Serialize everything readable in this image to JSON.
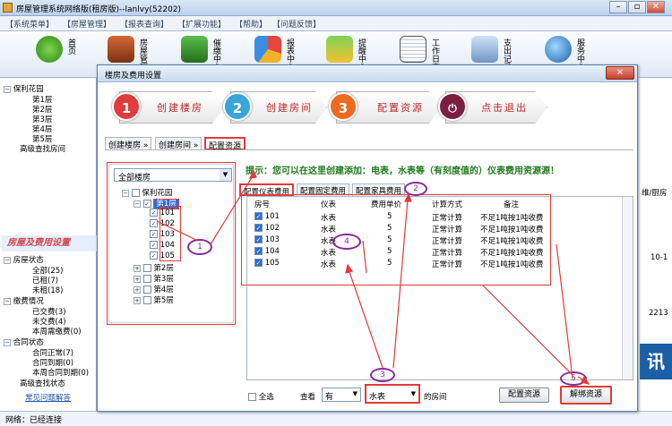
{
  "window": {
    "title": "房屋管理系统网络版(租房版)--lanlvy(52202)"
  },
  "menu": [
    "【系统菜单】",
    "【房屋管理】",
    "【报表查询】",
    "【扩展功能】",
    "【帮助】",
    "【问题反馈】"
  ],
  "toolbar": [
    {
      "label": "首页",
      "icon": "home-icon"
    },
    {
      "label": "房屋管理",
      "icon": "building-icon"
    },
    {
      "label": "催缴中心",
      "icon": "house-money-icon"
    },
    {
      "label": "报表中心",
      "icon": "chart-icon"
    },
    {
      "label": "提醒中心",
      "icon": "reminder-icon"
    },
    {
      "label": "工作日志",
      "icon": "notebook-icon"
    },
    {
      "label": "支出记录",
      "icon": "expense-icon"
    },
    {
      "label": "服务中心",
      "icon": "globe-icon"
    }
  ],
  "left_tree": {
    "root": "保利花园",
    "floors": [
      "第1层",
      "第2层",
      "第3层",
      "第4层",
      "第5层"
    ],
    "search": "高级查找房间"
  },
  "left_banner": "房屋及费用设置",
  "left_status": {
    "house_status": "房屋状态",
    "house_items": [
      "全部(25)",
      "已租(7)",
      "未租(18)"
    ],
    "payment": "缴费情况",
    "payment_items": [
      "已交费(3)",
      "未交费(4)",
      "本周需缴费(0)"
    ],
    "contract": "合同状态",
    "contract_items": [
      "合同正常(7)",
      "合同到期(0)",
      "本周合同到期(0)"
    ],
    "contract_search": "高级查找状态",
    "link": "常见问题解答"
  },
  "statusbar": "网络：已经连接",
  "right_partial": {
    "col": "维/厨房",
    "val1": "10-1",
    "val2": "2213",
    "brand": "讯"
  },
  "dialog": {
    "title": "楼房及费用设置",
    "steps": [
      {
        "num": "1",
        "label": "创建楼房",
        "color": "#e23b3b"
      },
      {
        "num": "2",
        "label": "创建房间",
        "color": "#38a6d8"
      },
      {
        "num": "3",
        "label": "配置资源",
        "color": "#ee6a1e"
      },
      {
        "num": "",
        "label": "点击退出",
        "color": "#7a1e42"
      }
    ],
    "tabs": [
      "创建楼房 »",
      "创建房间 »",
      "配置资源"
    ],
    "combo": "全部楼房",
    "tree": {
      "root": "保利花园",
      "floor1": "第1层",
      "rooms": [
        "101",
        "102",
        "103",
        "104",
        "105"
      ],
      "other_floors": [
        "第2层",
        "第3层",
        "第4层",
        "第5层"
      ]
    },
    "tip": "提示：您可以在这里创建添加：电表，水表等（有刻度值的）仪表费用资源源！",
    "subtabs": [
      "配置仪表费用",
      "配置固定费用",
      "配置家具费用"
    ],
    "grid": {
      "headers": [
        "房号",
        "仪表",
        "费用单价",
        "计算方式",
        "备注"
      ],
      "rows": [
        [
          "101",
          "水表",
          "5",
          "正常计算",
          "不足1吨按1吨收费"
        ],
        [
          "102",
          "水表",
          "5",
          "正常计算",
          "不足1吨按1吨收费"
        ],
        [
          "103",
          "水表",
          "5",
          "正常计算",
          "不足1吨按1吨收费"
        ],
        [
          "104",
          "水表",
          "5",
          "正常计算",
          "不足1吨按1吨收费"
        ],
        [
          "105",
          "水表",
          "5",
          "正常计算",
          "不足1吨按1吨收费"
        ]
      ]
    },
    "bottom": {
      "select_all": "全选",
      "view": "查看",
      "has": "有",
      "meter": "水表",
      "rooms_suffix": "的房间",
      "config_btn": "配置资源",
      "unbind_btn": "解绑资源"
    },
    "annotations": [
      "1",
      "2",
      "3",
      "4",
      "5"
    ]
  }
}
